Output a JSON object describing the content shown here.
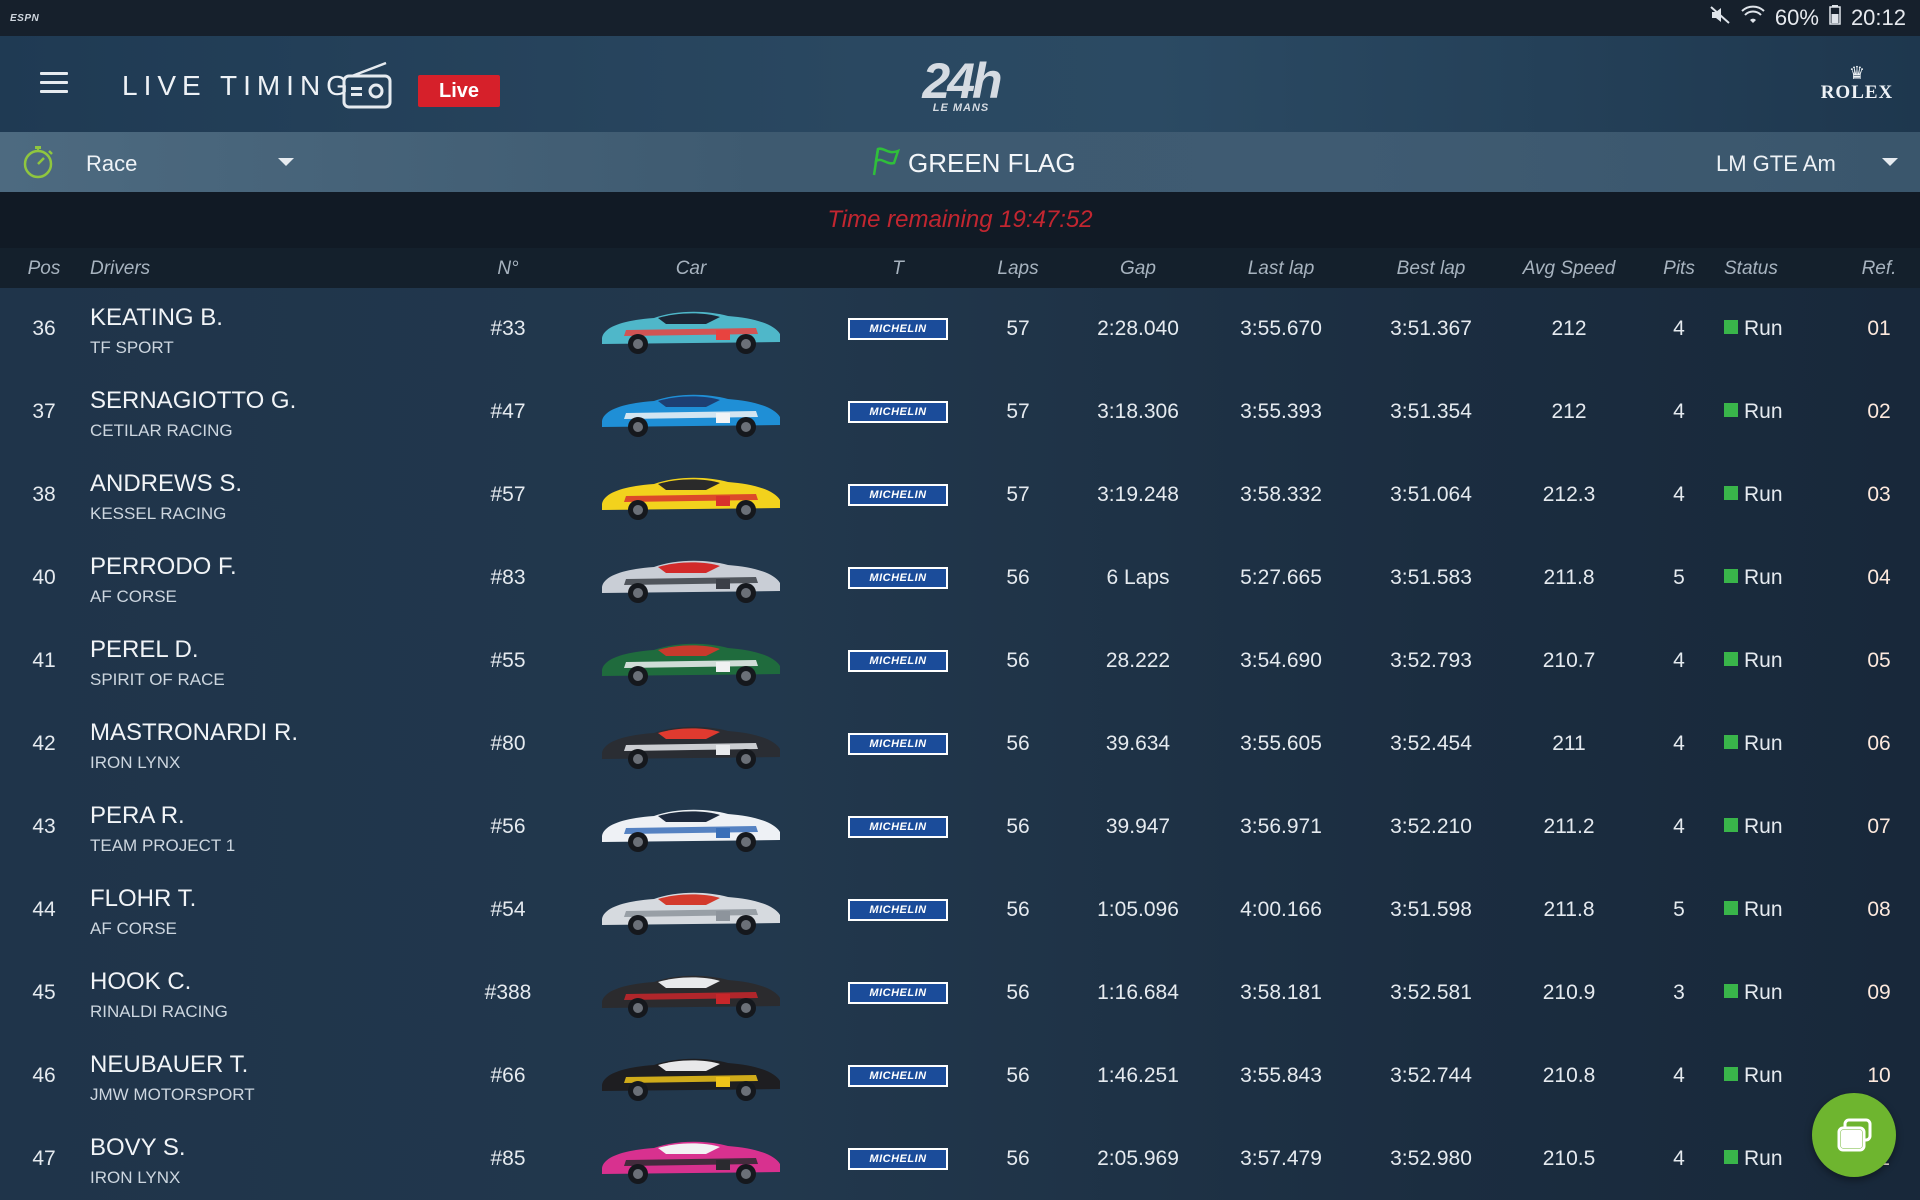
{
  "statusbar": {
    "brand": "ESPN",
    "battery": "60%",
    "time": "20:12"
  },
  "header": {
    "title": "LIVE TIMING",
    "live_label": "Live",
    "event_logo_main": "24h",
    "event_logo_sub": "LE MANS",
    "sponsor": "ROLEX"
  },
  "filters": {
    "session": "Race",
    "flag_status": "GREEN FLAG",
    "flag_color": "#2fbf3a",
    "car_class": "LM GTE Am"
  },
  "time_remaining": "Time remaining 19:47:52",
  "accent_colors": {
    "live": "#d6202a",
    "time_remaining_text": "#c22630",
    "ref_column": "#c96b38",
    "status_run": "#39b54a",
    "fab": "#6eb52f"
  },
  "columns": {
    "pos": "Pos",
    "drivers": "Drivers",
    "number": "N°",
    "car": "Car",
    "tyre": "T",
    "laps": "Laps",
    "gap": "Gap",
    "last_lap": "Last lap",
    "best_lap": "Best lap",
    "avg_speed": "Avg Speed",
    "pits": "Pits",
    "status": "Status",
    "ref": "Ref."
  },
  "rows": [
    {
      "pos": "36",
      "driver": "KEATING B.",
      "team": "TF SPORT",
      "number": "#33",
      "tyre": "MICHELIN",
      "laps": "57",
      "gap": "2:28.040",
      "last_lap": "3:55.670",
      "best_lap": "3:51.367",
      "avg_speed": "212",
      "pits": "4",
      "status": "Run",
      "ref": "01",
      "livery": [
        "#4fb7c9",
        "#e8433f",
        "#1b2636"
      ]
    },
    {
      "pos": "37",
      "driver": "SERNAGIOTTO G.",
      "team": "CETILAR RACING",
      "number": "#47",
      "tyre": "MICHELIN",
      "laps": "57",
      "gap": "3:18.306",
      "last_lap": "3:55.393",
      "best_lap": "3:51.354",
      "avg_speed": "212",
      "pits": "4",
      "status": "Run",
      "ref": "02",
      "livery": [
        "#1f8fd6",
        "#f2f4f6",
        "#1d3f73"
      ]
    },
    {
      "pos": "38",
      "driver": "ANDREWS S.",
      "team": "KESSEL RACING",
      "number": "#57",
      "tyre": "MICHELIN",
      "laps": "57",
      "gap": "3:19.248",
      "last_lap": "3:58.332",
      "best_lap": "3:51.064",
      "avg_speed": "212.3",
      "pits": "4",
      "status": "Run",
      "ref": "03",
      "livery": [
        "#f2d21d",
        "#d8322c",
        "#2a2a2a"
      ]
    },
    {
      "pos": "40",
      "driver": "PERRODO F.",
      "team": "AF CORSE",
      "number": "#83",
      "tyre": "MICHELIN",
      "laps": "56",
      "gap": "6 Laps",
      "last_lap": "5:27.665",
      "best_lap": "3:51.583",
      "avg_speed": "211.8",
      "pits": "5",
      "status": "Run",
      "ref": "04",
      "livery": [
        "#c9ced6",
        "#3b3f47",
        "#d22a2a"
      ]
    },
    {
      "pos": "41",
      "driver": "PEREL D.",
      "team": "SPIRIT OF RACE",
      "number": "#55",
      "tyre": "MICHELIN",
      "laps": "56",
      "gap": "28.222",
      "last_lap": "3:54.690",
      "best_lap": "3:52.793",
      "avg_speed": "210.7",
      "pits": "4",
      "status": "Run",
      "ref": "05",
      "livery": [
        "#1f6b3d",
        "#f0f1f2",
        "#c83a2c"
      ]
    },
    {
      "pos": "42",
      "driver": "MASTRONARDI R.",
      "team": "IRON LYNX",
      "number": "#80",
      "tyre": "MICHELIN",
      "laps": "56",
      "gap": "39.634",
      "last_lap": "3:55.605",
      "best_lap": "3:52.454",
      "avg_speed": "211",
      "pits": "4",
      "status": "Run",
      "ref": "06",
      "livery": [
        "#2a2d33",
        "#e8eaed",
        "#e03a2f"
      ]
    },
    {
      "pos": "43",
      "driver": "PERA R.",
      "team": "TEAM PROJECT 1",
      "number": "#56",
      "tyre": "MICHELIN",
      "laps": "56",
      "gap": "39.947",
      "last_lap": "3:56.971",
      "best_lap": "3:52.210",
      "avg_speed": "211.2",
      "pits": "4",
      "status": "Run",
      "ref": "07",
      "livery": [
        "#eef1f5",
        "#3a6fb8",
        "#1d2a3e"
      ]
    },
    {
      "pos": "44",
      "driver": "FLOHR T.",
      "team": "AF CORSE",
      "number": "#54",
      "tyre": "MICHELIN",
      "laps": "56",
      "gap": "1:05.096",
      "last_lap": "4:00.166",
      "best_lap": "3:51.598",
      "avg_speed": "211.8",
      "pits": "5",
      "status": "Run",
      "ref": "08",
      "livery": [
        "#d6dadf",
        "#8d949c",
        "#d33a2c"
      ]
    },
    {
      "pos": "45",
      "driver": "HOOK C.",
      "team": "RINALDI RACING",
      "number": "#388",
      "tyre": "MICHELIN",
      "laps": "56",
      "gap": "1:16.684",
      "last_lap": "3:58.181",
      "best_lap": "3:52.581",
      "avg_speed": "210.9",
      "pits": "3",
      "status": "Run",
      "ref": "09",
      "livery": [
        "#2b2b2e",
        "#c8262a",
        "#e9eaec"
      ]
    },
    {
      "pos": "46",
      "driver": "NEUBAUER T.",
      "team": "JMW MOTORSPORT",
      "number": "#66",
      "tyre": "MICHELIN",
      "laps": "56",
      "gap": "1:46.251",
      "last_lap": "3:55.843",
      "best_lap": "3:52.744",
      "avg_speed": "210.8",
      "pits": "4",
      "status": "Run",
      "ref": "10",
      "livery": [
        "#1e1e21",
        "#f0c419",
        "#e8e8ea"
      ]
    },
    {
      "pos": "47",
      "driver": "BOVY S.",
      "team": "IRON LYNX",
      "number": "#85",
      "tyre": "MICHELIN",
      "laps": "56",
      "gap": "2:05.969",
      "last_lap": "3:57.479",
      "best_lap": "3:52.980",
      "avg_speed": "210.5",
      "pits": "4",
      "status": "Run",
      "ref": "11",
      "livery": [
        "#d8318f",
        "#2a2a2f",
        "#f2f2f4"
      ]
    }
  ],
  "icons": {
    "menu": "menu-icon",
    "radio": "radio-icon",
    "stopwatch": "stopwatch-icon",
    "flag": "flag-icon",
    "fab": "chat-window-icon"
  }
}
